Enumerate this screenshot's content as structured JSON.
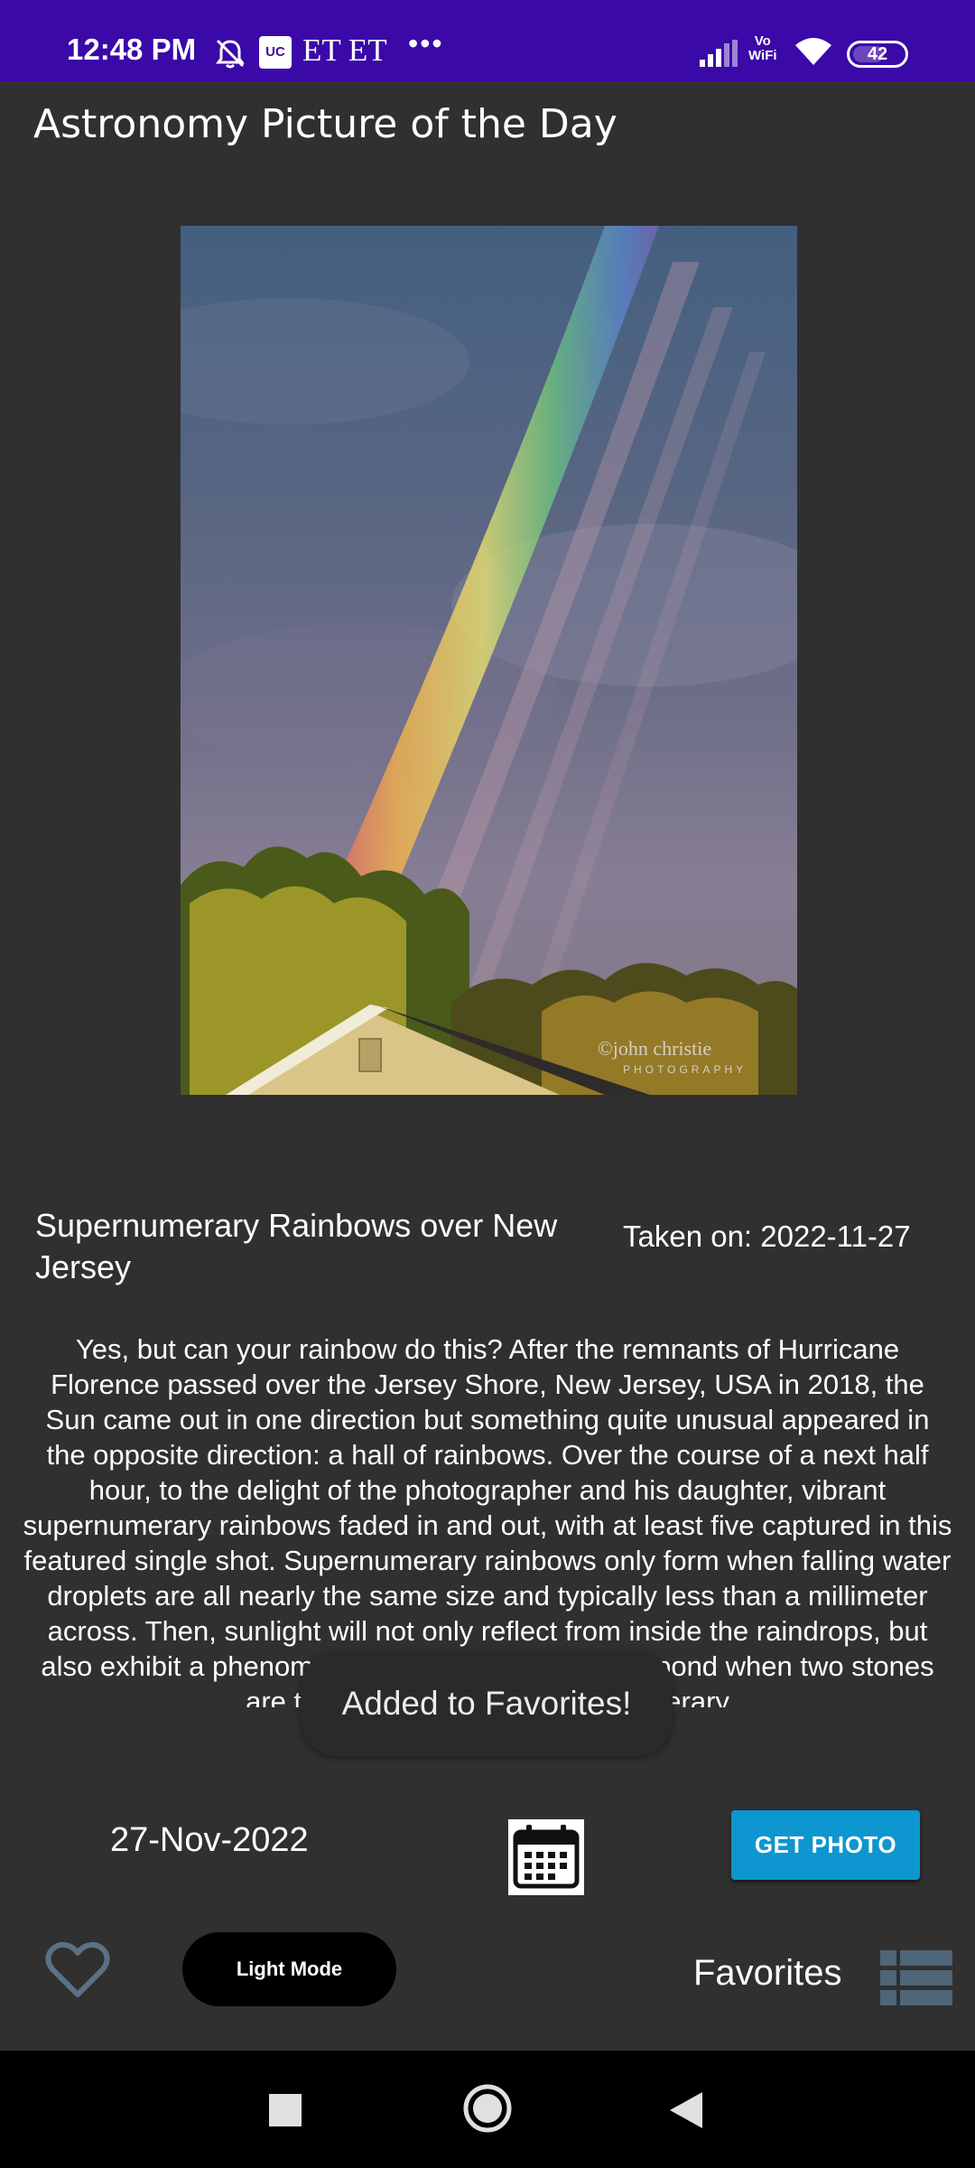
{
  "status_bar": {
    "time": "12:48 PM",
    "uc_badge": "UC",
    "et_text": "ET ET",
    "more": "•••",
    "vowifi_top": "Vo",
    "vowifi_bottom": "WiFi",
    "battery": "42"
  },
  "app": {
    "title": "Astronomy Picture of the Day"
  },
  "photo": {
    "watermark": "©john christie",
    "watermark_sub": "PHOTOGRAPHY",
    "title": "Supernumerary Rainbows over New Jersey",
    "taken_on": "Taken on: 2022-11-27",
    "description": "Yes, but can your rainbow do this?  After the remnants of Hurricane Florence passed over the Jersey Shore, New Jersey, USA in 2018, the Sun came out in one direction but something quite unusual appeared in the opposite direction: a hall of rainbows.  Over the course of a next half hour, to the delight of the photographer and his daughter, vibrant supernumerary rainbows faded in and out, with at least five captured in this featured single shot.  Supernumerary rainbows only form when falling water droplets are all nearly the same size and typically less than a millimeter across.  Then, sunlight will not only reflect from inside the raindrops, but also exhibit a phenomenon similar to ripples on a pond when two stones are thrown in — in fact, supernumerary"
  },
  "toast": {
    "message": "Added to Favorites!"
  },
  "controls": {
    "date": "27-Nov-2022",
    "get_photo_label": "GET PHOTO",
    "light_mode_label": "Light Mode",
    "favorites_label": "Favorites"
  },
  "colors": {
    "status_bar": "#3a09a8",
    "background": "#303030",
    "accent_button": "#0d96cf",
    "heart": "#5c7184",
    "list_icon": "#4f6578"
  },
  "icons": {
    "dnd": "bell-off-icon",
    "signal": "signal-icon",
    "wifi": "wifi-icon",
    "calendar": "calendar-icon",
    "heart": "heart-outline-icon",
    "list": "list-icon",
    "nav_recents": "square-icon",
    "nav_home": "circle-icon",
    "nav_back": "triangle-back-icon"
  }
}
